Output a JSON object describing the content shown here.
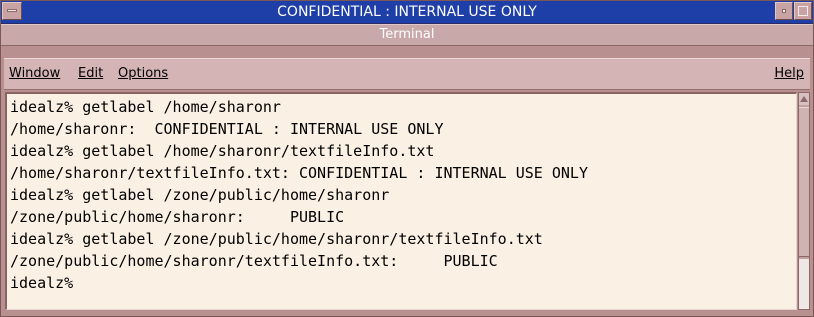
{
  "label_bar": {
    "text": "CONFIDENTIAL : INTERNAL USE ONLY"
  },
  "window": {
    "title": "Terminal"
  },
  "menu": {
    "window": "Window",
    "edit": "Edit",
    "options": "Options",
    "help": "Help"
  },
  "terminal": {
    "lines": [
      "idealz% getlabel /home/sharonr",
      "/home/sharonr:  CONFIDENTIAL : INTERNAL USE ONLY",
      "idealz% getlabel /home/sharonr/textfileInfo.txt",
      "/home/sharonr/textfileInfo.txt: CONFIDENTIAL : INTERNAL USE ONLY",
      "idealz% getlabel /zone/public/home/sharonr",
      "/zone/public/home/sharonr:     PUBLIC",
      "idealz% getlabel /zone/public/home/sharonr/textfileInfo.txt",
      "/zone/public/home/sharonr/textfileInfo.txt:     PUBLIC",
      "idealz%"
    ]
  },
  "colors": {
    "label_bar": "#1e3ea8",
    "window_frame": "#b89090",
    "terminal_bg": "#fbf0e4"
  }
}
